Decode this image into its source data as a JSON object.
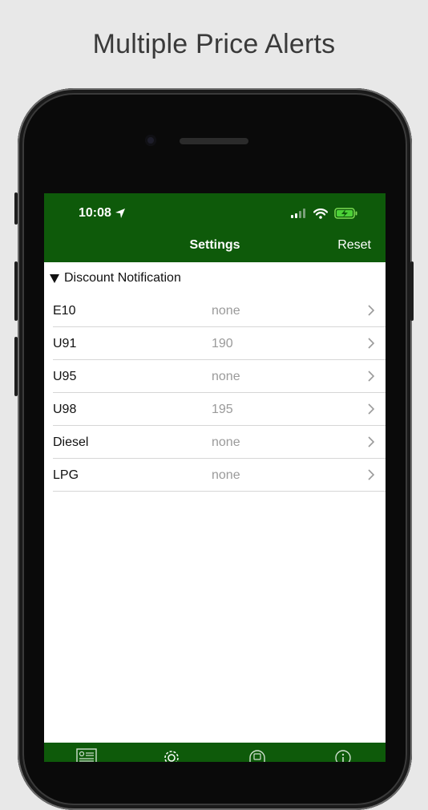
{
  "headline": "Multiple Price Alerts",
  "status_bar": {
    "time": "10:08"
  },
  "nav": {
    "title": "Settings",
    "reset_label": "Reset"
  },
  "section": {
    "title": "Discount Notification"
  },
  "fuel_rows": [
    {
      "label": "E10",
      "value": "none"
    },
    {
      "label": "U91",
      "value": "190"
    },
    {
      "label": "U95",
      "value": "none"
    },
    {
      "label": "U98",
      "value": "195"
    },
    {
      "label": "Diesel",
      "value": "none"
    },
    {
      "label": "LPG",
      "value": "none"
    }
  ],
  "colors": {
    "bar_green": "#0e5a0a",
    "value_gray": "#9a9a9a",
    "separator": "#d6d6d6"
  },
  "tab_icons": [
    "news-icon",
    "gear-icon",
    "fuel-station-icon",
    "info-icon"
  ]
}
